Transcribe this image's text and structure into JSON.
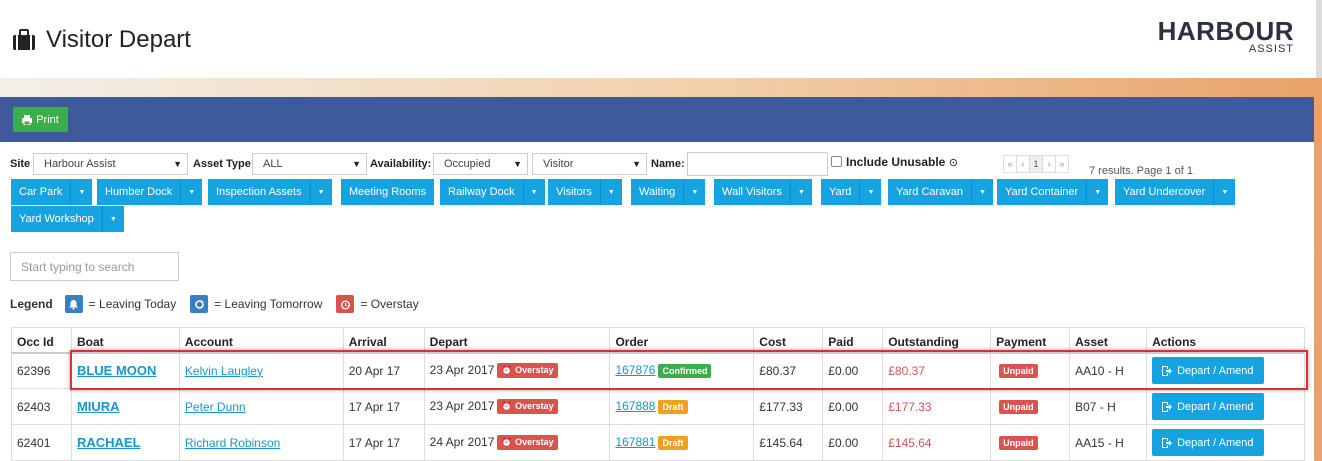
{
  "header": {
    "title": "Visitor Depart",
    "logo_main": "HARBOUR",
    "logo_sub": "ASSIST"
  },
  "toolbar": {
    "print_label": "Print"
  },
  "filters": {
    "site_label": "Site",
    "site_value": "Harbour Assist",
    "asset_type_label": "Asset Type",
    "asset_type_value": "ALL",
    "availability_label": "Availability:",
    "availability_value": "Occupied",
    "type_value": "Visitor",
    "name_label": "Name:",
    "name_value": "",
    "include_unusable_label": "Include Unusable",
    "pager": [
      "«",
      "‹",
      "1",
      "›",
      "»"
    ],
    "results_text": "7 results. Page 1 of 1"
  },
  "asset_groups": [
    "Car Park",
    "Humber Dock",
    "Inspection Assets",
    "Meeting Rooms",
    "Railway Dock",
    "Visitors",
    "Waiting",
    "Wall Visitors",
    "Yard",
    "Yard Caravan",
    "Yard Container",
    "Yard Undercover",
    "Yard Workshop"
  ],
  "search": {
    "placeholder": "Start typing to search"
  },
  "legend": {
    "title": "Legend",
    "items": [
      {
        "label": "= Leaving Today",
        "icon": "bell-icon",
        "color": "#3a7fc1"
      },
      {
        "label": "= Leaving Tomorrow",
        "icon": "refresh-icon",
        "color": "#3a7fc1"
      },
      {
        "label": "= Overstay",
        "icon": "alarm-icon",
        "color": "#d9534f"
      }
    ]
  },
  "table": {
    "columns": [
      "Occ Id",
      "Boat",
      "Account",
      "Arrival",
      "Depart",
      "Order",
      "Cost",
      "Paid",
      "Outstanding",
      "Payment",
      "Asset",
      "Actions"
    ],
    "rows": [
      {
        "occ_id": "62396",
        "boat": "BLUE MOON",
        "account": "Kelvin Laugley",
        "arrival": "20 Apr 17",
        "depart": "23 Apr 2017",
        "depart_badge": "Overstay",
        "order": "167876",
        "order_badge": "Confirmed",
        "cost": "£80.37",
        "paid": "£0.00",
        "outstanding": "£80.37",
        "payment": "Unpaid",
        "asset": "AA10 - H",
        "action": "Depart / Amend"
      },
      {
        "occ_id": "62403",
        "boat": "MIURA",
        "account": "Peter Dunn",
        "arrival": "17 Apr 17",
        "depart": "23 Apr 2017",
        "depart_badge": "Overstay",
        "order": "167888",
        "order_badge": "Draft",
        "cost": "£177.33",
        "paid": "£0.00",
        "outstanding": "£177.33",
        "payment": "Unpaid",
        "asset": "B07 - H",
        "action": "Depart / Amend"
      },
      {
        "occ_id": "62401",
        "boat": "RACHAEL",
        "account": "Richard Robinson",
        "arrival": "17 Apr 17",
        "depart": "24 Apr 2017",
        "depart_badge": "Overstay",
        "order": "167881",
        "order_badge": "Draft",
        "cost": "£145.64",
        "paid": "£0.00",
        "outstanding": "£145.64",
        "payment": "Unpaid",
        "asset": "AA15 - H",
        "action": "Depart / Amend"
      }
    ]
  },
  "colors": {
    "accent": "#15a4e1",
    "header_bar": "#3f5a9a",
    "print_button": "#3cae49",
    "danger": "#d9534f",
    "draft": "#f0a020"
  }
}
